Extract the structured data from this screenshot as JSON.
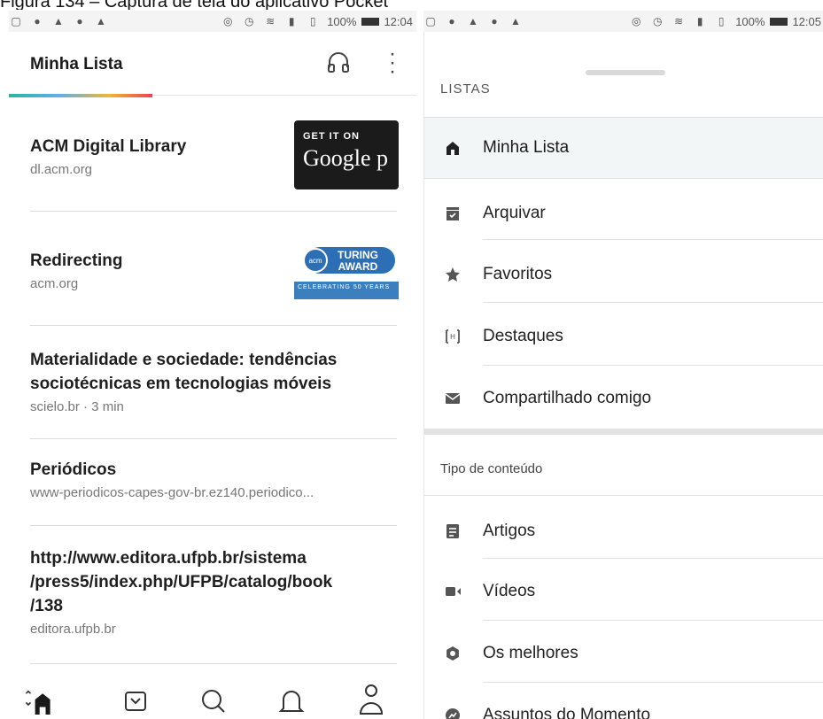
{
  "caption": "Figura 134 – Captura de tela do aplicativo Pocket",
  "status_left": {
    "battery": "100%",
    "time": "12:04"
  },
  "status_right": {
    "battery": "100%",
    "time": "12:05"
  },
  "left": {
    "title": "Minha Lista",
    "items": [
      {
        "title": "ACM Digital Library",
        "sub": "dl.acm.org"
      },
      {
        "title": "Redirecting",
        "sub": "acm.org"
      },
      {
        "title": "Materialidade e sociedade: tendências sociotécnicas em tecnologias móveis",
        "sub": "scielo.br · 3 min"
      },
      {
        "title": "Periódicos",
        "sub": "www-periodicos-capes-gov-br.ez140.periodico..."
      },
      {
        "title": "http://www.editora.ufpb.br/sistema/press5/index.php/UFPB/catalog/book/138",
        "title_lines": [
          "http://www.editora.ufpb.br/sistema",
          "/press5/index.php/UFPB/catalog/book",
          "/138"
        ],
        "sub": "editora.ufpb.br"
      }
    ],
    "thumbs": {
      "google_line1": "GET IT ON",
      "google_line2": "Google p",
      "turing_line1": "TURING",
      "turing_line2": "AWARD",
      "turing_strip": "CELEBRATING 50 YEARS"
    }
  },
  "right": {
    "section_top": "LISTAS",
    "lists": [
      {
        "label": "Minha Lista",
        "icon": "home-icon"
      },
      {
        "label": "Arquivar",
        "icon": "archive-icon"
      },
      {
        "label": "Favoritos",
        "icon": "star-icon"
      },
      {
        "label": "Destaques",
        "icon": "highlight-icon"
      },
      {
        "label": "Compartilhado comigo",
        "icon": "mail-icon"
      }
    ],
    "section_content": "Tipo de conteúdo",
    "content": [
      {
        "label": "Artigos",
        "icon": "article-icon"
      },
      {
        "label": "Vídeos",
        "icon": "video-icon"
      },
      {
        "label": "Os melhores",
        "icon": "best-icon"
      },
      {
        "label": "Assuntos do Momento",
        "icon": "trending-icon"
      }
    ]
  },
  "colors": {
    "accent_teal": "#2bb3a6",
    "accent_red": "#ef4056",
    "active_bg": "#f2f6f7"
  }
}
